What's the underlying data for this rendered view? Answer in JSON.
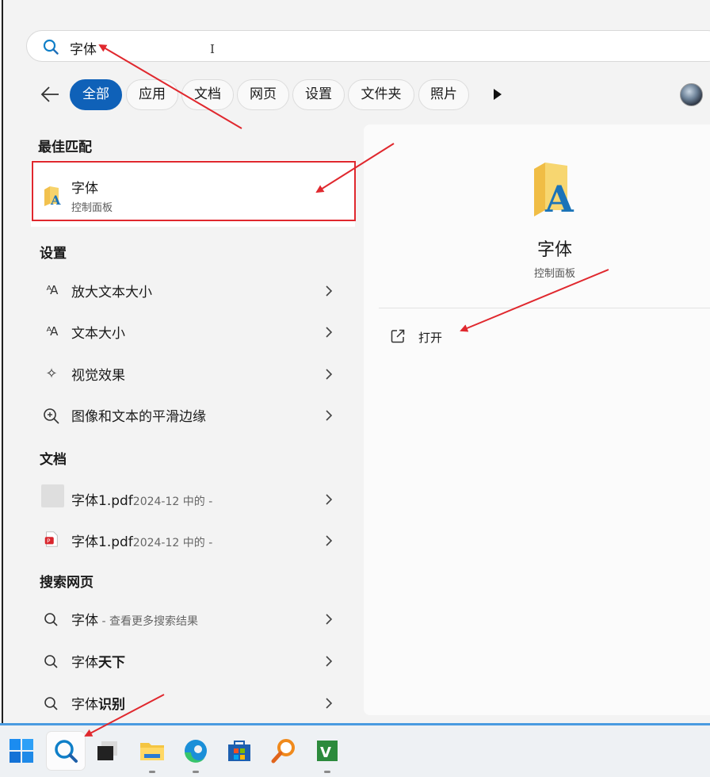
{
  "search": {
    "query": "字体"
  },
  "filters": {
    "items": [
      {
        "label": "全部",
        "active": true
      },
      {
        "label": "应用"
      },
      {
        "label": "文档"
      },
      {
        "label": "网页"
      },
      {
        "label": "设置"
      },
      {
        "label": "文件夹"
      },
      {
        "label": "照片"
      }
    ]
  },
  "best_match": {
    "title": "最佳匹配",
    "name": "字体",
    "subtitle": "控制面板"
  },
  "settings": {
    "title": "设置",
    "items": [
      {
        "label": "放大文本大小",
        "icon": "text-size-icon"
      },
      {
        "label": "文本大小",
        "icon": "text-size-icon"
      },
      {
        "label": "视觉效果",
        "icon": "sparkle-icon"
      },
      {
        "label": "图像和文本的平滑边缘",
        "icon": "zoom-icon"
      }
    ]
  },
  "documents": {
    "title": "文档",
    "items": [
      {
        "name": "字体1.pdf",
        "meta": "2024-12 中的 -",
        "icon": "blank-file-icon"
      },
      {
        "name": "字体1.pdf",
        "meta": "2024-12 中的 -",
        "icon": "pdf-icon"
      }
    ]
  },
  "web": {
    "title": "搜索网页",
    "items": [
      {
        "prefix": "字体",
        "rest": " - 查看更多搜索结果"
      },
      {
        "prefix": "字体",
        "rest": "天下"
      },
      {
        "prefix": "字体",
        "rest": "识别"
      }
    ]
  },
  "detail": {
    "name": "字体",
    "subtitle": "控制面板",
    "actions": [
      {
        "label": "打开",
        "icon": "open-external-icon"
      }
    ]
  },
  "colors": {
    "accent": "#0f61b8",
    "annotation": "#e0282e"
  },
  "taskbar": {
    "items": [
      "windows-start-icon",
      "search-icon",
      "task-view-icon",
      "file-explorer-icon",
      "edge-icon",
      "store-icon",
      "magnifier-app-icon",
      "vim-icon"
    ]
  }
}
